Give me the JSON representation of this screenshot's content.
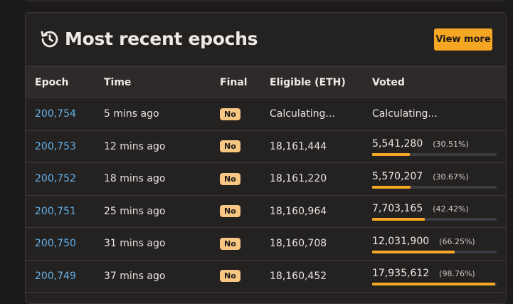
{
  "card": {
    "title": "Most recent epochs",
    "view_more_label": "View more"
  },
  "table": {
    "headers": {
      "epoch": "Epoch",
      "time": "Time",
      "final": "Final",
      "eligible": "Eligible (ETH)",
      "voted": "Voted"
    },
    "rows": [
      {
        "epoch": "200,754",
        "time": "5 mins ago",
        "final": "No",
        "eligible": "Calculating...",
        "voted": "Calculating...",
        "pct": "",
        "fill": null
      },
      {
        "epoch": "200,753",
        "time": "12 mins ago",
        "final": "No",
        "eligible": "18,161,444",
        "voted": "5,541,280",
        "pct": "(30.51%)",
        "fill": 30.51
      },
      {
        "epoch": "200,752",
        "time": "18 mins ago",
        "final": "No",
        "eligible": "18,161,220",
        "voted": "5,570,207",
        "pct": "(30.67%)",
        "fill": 30.67
      },
      {
        "epoch": "200,751",
        "time": "25 mins ago",
        "final": "No",
        "eligible": "18,160,964",
        "voted": "7,703,165",
        "pct": "(42.42%)",
        "fill": 42.42
      },
      {
        "epoch": "200,750",
        "time": "31 mins ago",
        "final": "No",
        "eligible": "18,160,708",
        "voted": "12,031,900",
        "pct": "(66.25%)",
        "fill": 66.25
      },
      {
        "epoch": "200,749",
        "time": "37 mins ago",
        "final": "No",
        "eligible": "18,160,452",
        "voted": "17,935,612",
        "pct": "(98.76%)",
        "fill": 98.76
      }
    ]
  },
  "colors": {
    "accent": "#f5a623",
    "link": "#64b2ea",
    "badge": "#f7c683",
    "background": "#1c1a1a",
    "card": "#242121"
  },
  "icons": {
    "title_icon": "history-icon"
  }
}
